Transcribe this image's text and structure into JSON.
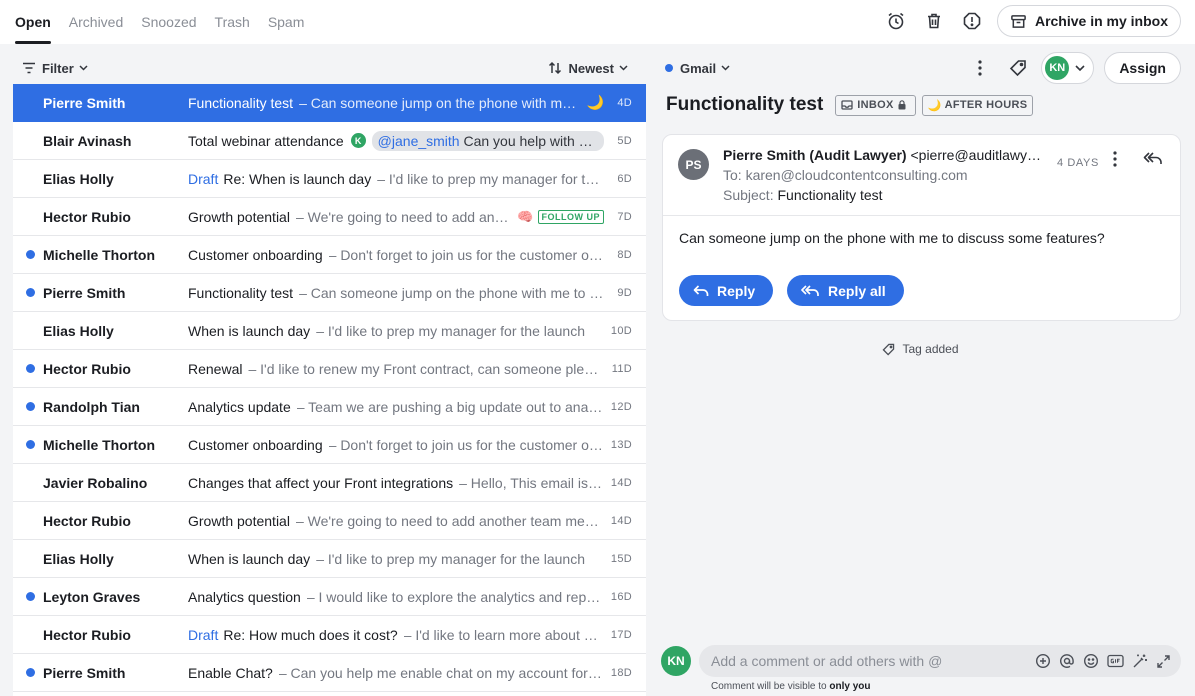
{
  "tabs": [
    {
      "label": "Open",
      "active": true
    },
    {
      "label": "Archived",
      "active": false
    },
    {
      "label": "Snoozed",
      "active": false
    },
    {
      "label": "Trash",
      "active": false
    },
    {
      "label": "Spam",
      "active": false
    }
  ],
  "top_actions": {
    "archive_label": "Archive in my inbox"
  },
  "list_header": {
    "filter_label": "Filter",
    "sort_label": "Newest"
  },
  "conversations": [
    {
      "sender": "Pierre Smith",
      "unread": false,
      "selected": true,
      "draft": "",
      "subject": "Functionality test",
      "snippet": "– Can someone jump on the phone with me to discuss some features?",
      "age": "4D",
      "extra": "moon"
    },
    {
      "sender": "Blair Avinash",
      "unread": false,
      "draft": "",
      "subject": "Total webinar attendance",
      "badge": "K",
      "mention": "@jane_smith",
      "mention_text": "Can you help with this?",
      "age": "5D"
    },
    {
      "sender": "Elias Holly",
      "unread": false,
      "draft": "Draft",
      "subject": "Re: When is launch day",
      "snippet": "– I'd like to prep my manager for the launch",
      "age": "6D"
    },
    {
      "sender": "Hector Rubio",
      "unread": false,
      "draft": "",
      "subject": "Growth potential",
      "snippet": "– We're going to need to add another team",
      "age": "7D",
      "extra": "followup",
      "followup_label": "FOLLOW UP"
    },
    {
      "sender": "Michelle Thorton",
      "unread": true,
      "draft": "",
      "subject": "Customer onboarding",
      "snippet": "– Don't forget to join us for the customer onboarding session",
      "age": "8D"
    },
    {
      "sender": "Pierre Smith",
      "unread": true,
      "draft": "",
      "subject": "Functionality test",
      "snippet": "– Can someone jump on the phone with me to discuss some features?",
      "age": "9D"
    },
    {
      "sender": "Elias Holly",
      "unread": false,
      "draft": "",
      "subject": "When is launch day",
      "snippet": "– I'd like to prep my manager for the launch",
      "age": "10D"
    },
    {
      "sender": "Hector Rubio",
      "unread": true,
      "draft": "",
      "subject": "Renewal",
      "snippet": "– I'd like to renew my Front contract, can someone please help?",
      "age": "11D"
    },
    {
      "sender": "Randolph Tian",
      "unread": true,
      "draft": "",
      "subject": "Analytics update",
      "snippet": "– Team we are pushing a big update out to analytics",
      "age": "12D"
    },
    {
      "sender": "Michelle Thorton",
      "unread": true,
      "draft": "",
      "subject": "Customer onboarding",
      "snippet": "– Don't forget to join us for the customer onboarding session",
      "age": "13D"
    },
    {
      "sender": "Javier Robalino",
      "unread": false,
      "draft": "",
      "subject": "Changes that affect your Front integrations",
      "snippet": "– Hello, This email is to inform you",
      "age": "14D"
    },
    {
      "sender": "Hector Rubio",
      "unread": false,
      "draft": "",
      "subject": "Growth potential",
      "snippet": "– We're going to need to add another team member",
      "age": "14D"
    },
    {
      "sender": "Elias Holly",
      "unread": false,
      "draft": "",
      "subject": "When is launch day",
      "snippet": "– I'd like to prep my manager for the launch",
      "age": "15D"
    },
    {
      "sender": "Leyton Graves",
      "unread": true,
      "draft": "",
      "subject": "Analytics question",
      "snippet": "– I would like to explore the analytics and reporting",
      "age": "16D"
    },
    {
      "sender": "Hector Rubio",
      "unread": false,
      "draft": "Draft",
      "subject": "Re: How much does it cost?",
      "snippet": "– I'd like to learn more about pricing",
      "age": "17D"
    },
    {
      "sender": "Pierre Smith",
      "unread": true,
      "draft": "",
      "subject": "Enable Chat?",
      "snippet": "– Can you help me enable chat on my account for the team?",
      "age": "18D"
    }
  ],
  "reader": {
    "inbox_name": "Gmail",
    "avatar_initials": "KN",
    "assign_label": "Assign",
    "title": "Functionality test",
    "chip_inbox": "INBOX",
    "chip_hours": "AFTER HOURS",
    "message": {
      "avatar": "PS",
      "from_name": "Pierre Smith (Audit Lawyer)",
      "from_email": "<pierre@auditlawyer.com>",
      "to": "To: karen@cloudcontentconsulting.com",
      "subject_label": "Subject:",
      "subject": "Functionality test",
      "age": "4 DAYS",
      "body": "Can someone jump on the phone with me to discuss some features?",
      "reply_label": "Reply",
      "reply_all_label": "Reply all"
    },
    "activity": "Tag added",
    "composer": {
      "avatar": "KN",
      "placeholder": "Add a comment or add others with @",
      "note_prefix": "Comment will be visible to ",
      "note_strong": "only you"
    }
  },
  "colors": {
    "accent": "#2f6ee3",
    "green": "#2fa564"
  }
}
